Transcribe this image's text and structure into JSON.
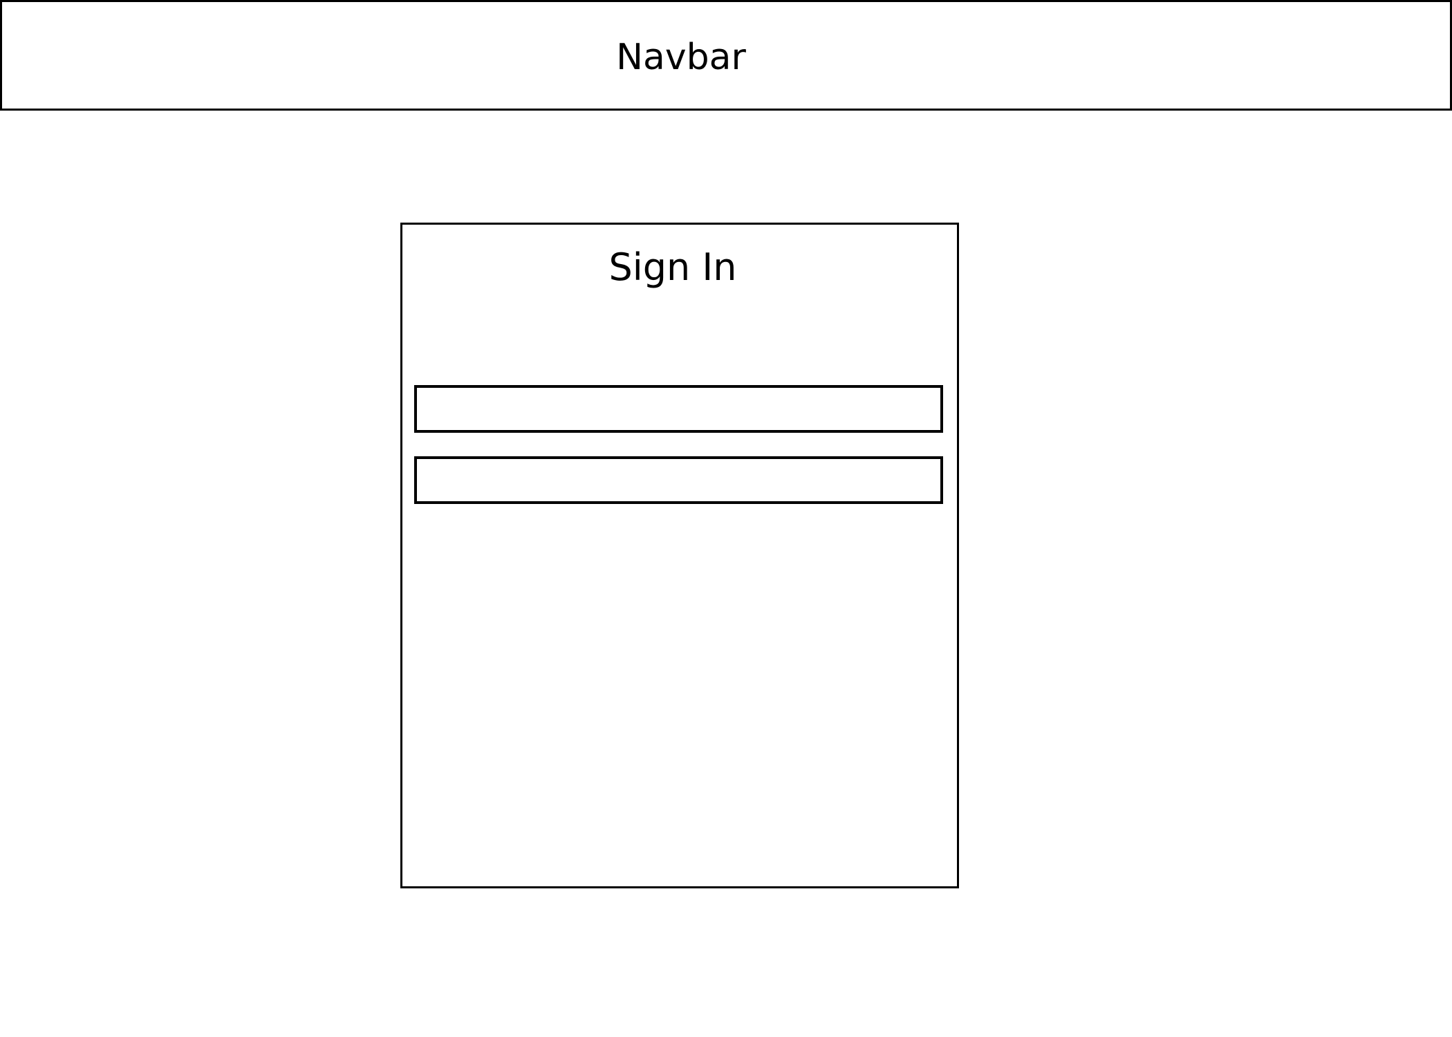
{
  "navbar": {
    "label": "Navbar"
  },
  "signin": {
    "title": "Sign In",
    "fields": [
      {
        "value": "",
        "placeholder": ""
      },
      {
        "value": "",
        "placeholder": ""
      }
    ]
  }
}
